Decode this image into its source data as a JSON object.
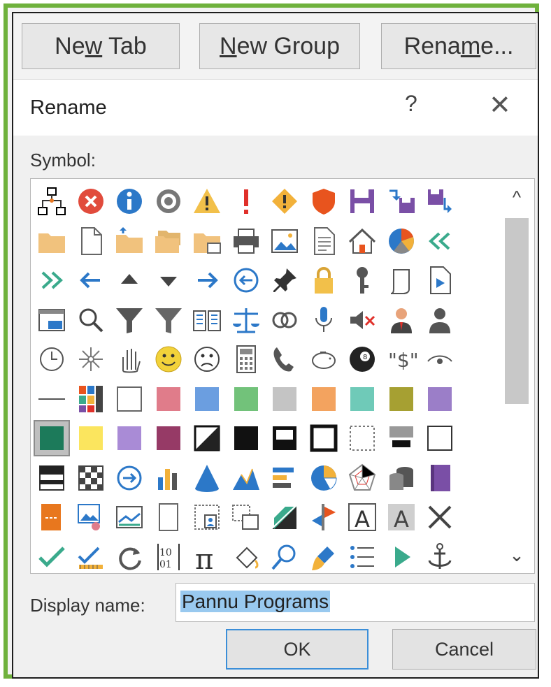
{
  "toolbar": {
    "new_tab": {
      "pre": "Ne",
      "u": "w",
      "post": " Tab"
    },
    "new_group": {
      "pre": "",
      "u": "N",
      "post": "ew Group"
    },
    "rename": {
      "pre": "Rena",
      "u": "m",
      "post": "e..."
    }
  },
  "dialog": {
    "title": "Rename",
    "help": "?",
    "close": "✕",
    "symbol_label": "Symbol:",
    "display_name_label": "Display name:",
    "display_name_value": "Pannu Programs",
    "ok": "OK",
    "cancel": "Cancel",
    "scroll_up": "^",
    "scroll_down": "⌄"
  },
  "symbols": [
    [
      "org-chart",
      "error-circle",
      "info-circle",
      "target-circle",
      "warning-triangle",
      "exclamation",
      "diamond-warning",
      "shield",
      "save-disk",
      "save-to",
      "save-from"
    ],
    [
      "folder",
      "document",
      "folder-up",
      "folders",
      "folder-stack",
      "printer",
      "picture",
      "document-list",
      "home",
      "pie-chart",
      "double-left-arrow"
    ],
    [
      "double-right-arrow",
      "left-arrow",
      "up-triangle",
      "down-triangle",
      "right-arrow",
      "back-circle",
      "pin",
      "padlock",
      "key",
      "page-curl",
      "page-play"
    ],
    [
      "window-frame",
      "magnifier",
      "filter",
      "filter-alt",
      "open-book",
      "scales",
      "rings",
      "microphone",
      "speaker-mute",
      "user-suit",
      "user"
    ],
    [
      "clock",
      "sparkle",
      "hand",
      "smiley",
      "frown",
      "calculator",
      "phone",
      "piggy-bank",
      "eight-ball",
      "dollar-quote",
      "eye"
    ],
    [
      "line",
      "color-palette",
      "white-square",
      "pink-square",
      "blue-square",
      "green-square",
      "gray-square",
      "orange-square",
      "teal-square",
      "olive-square",
      "purple-square"
    ],
    [
      "dark-green-square",
      "yellow-square",
      "lavender-square",
      "maroon-square",
      "contrast-square",
      "black-square",
      "black-frame-square",
      "bold-frame-square",
      "dotted-square",
      "gray-black-square",
      "thin-square"
    ],
    [
      "banner-square",
      "checker",
      "circle-arrow",
      "bar-chart",
      "cone",
      "mountains",
      "horizontal-bars",
      "pie-blue",
      "radar",
      "database",
      "purple-book"
    ],
    [
      "orange-book",
      "image-edit",
      "chart-picture",
      "blank-page",
      "contact-card",
      "layers",
      "slanted-box",
      "flag-arrows",
      "text-a",
      "text-a-gray",
      "cross"
    ],
    [
      "checkmark",
      "check-pen",
      "refresh",
      "binary",
      "pi",
      "paint-bucket",
      "search-lens",
      "paint-brush",
      "bullet-list",
      "play",
      "anchor"
    ]
  ],
  "selected_symbol": "dark-green-square",
  "colors": {
    "border_green": "#6fb13c",
    "accent_blue": "#3b8ed8",
    "selection": "#99c9ef"
  }
}
